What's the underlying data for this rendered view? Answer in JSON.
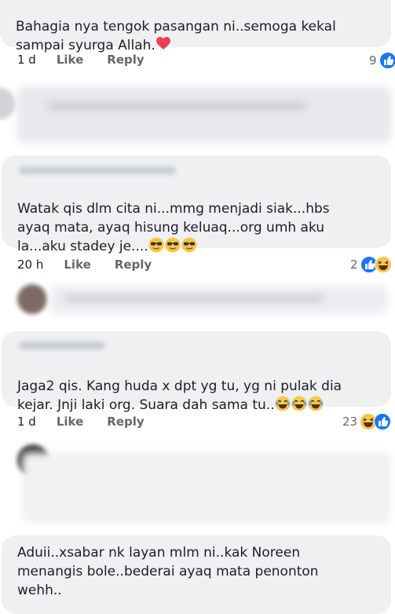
{
  "comments": [
    {
      "text": "Bahagia nya tengok pasangan ni..semoga kekal\nsampai syurga Allah.",
      "time": "1 d",
      "like": "Like",
      "reply": "Reply",
      "count": "9",
      "emoji": [
        "heart"
      ],
      "reactions": [
        "like"
      ]
    },
    {
      "text": "Watak qis dlm cita ni...mmg menjadi siak...hbs\nayaq mata, ayaq hisung keluaq...org umh aku\nla...aku stadey je....",
      "time": "20 h",
      "like": "Like",
      "reply": "Reply",
      "count": "2",
      "emoji": [
        "sunglasses-face",
        "sunglasses-face",
        "sunglasses-face"
      ],
      "reactions": [
        "like",
        "haha"
      ]
    },
    {
      "text": "Jaga2 qis. Kang huda x dpt yg tu, yg ni pulak dia\nkejar. Jnji laki org. Suara dah sama tu..",
      "time": "1 d",
      "like": "Like",
      "reply": "Reply",
      "count": "23",
      "emoji": [
        "tears-of-joy-face",
        "tears-of-joy-face",
        "tears-of-joy-face"
      ],
      "reactions": [
        "haha",
        "like"
      ]
    },
    {
      "text": "Aduii..xsabar nk layan mlm ni..kak Noreen\nmenangis bole..bederai ayaq mata penonton\nwehh.."
    }
  ],
  "colors": {
    "bubble": "#eef0f2",
    "like_blue": "#1877f2",
    "heart_red": "#e8424e",
    "emoji_yellow": "#f7c64a"
  }
}
